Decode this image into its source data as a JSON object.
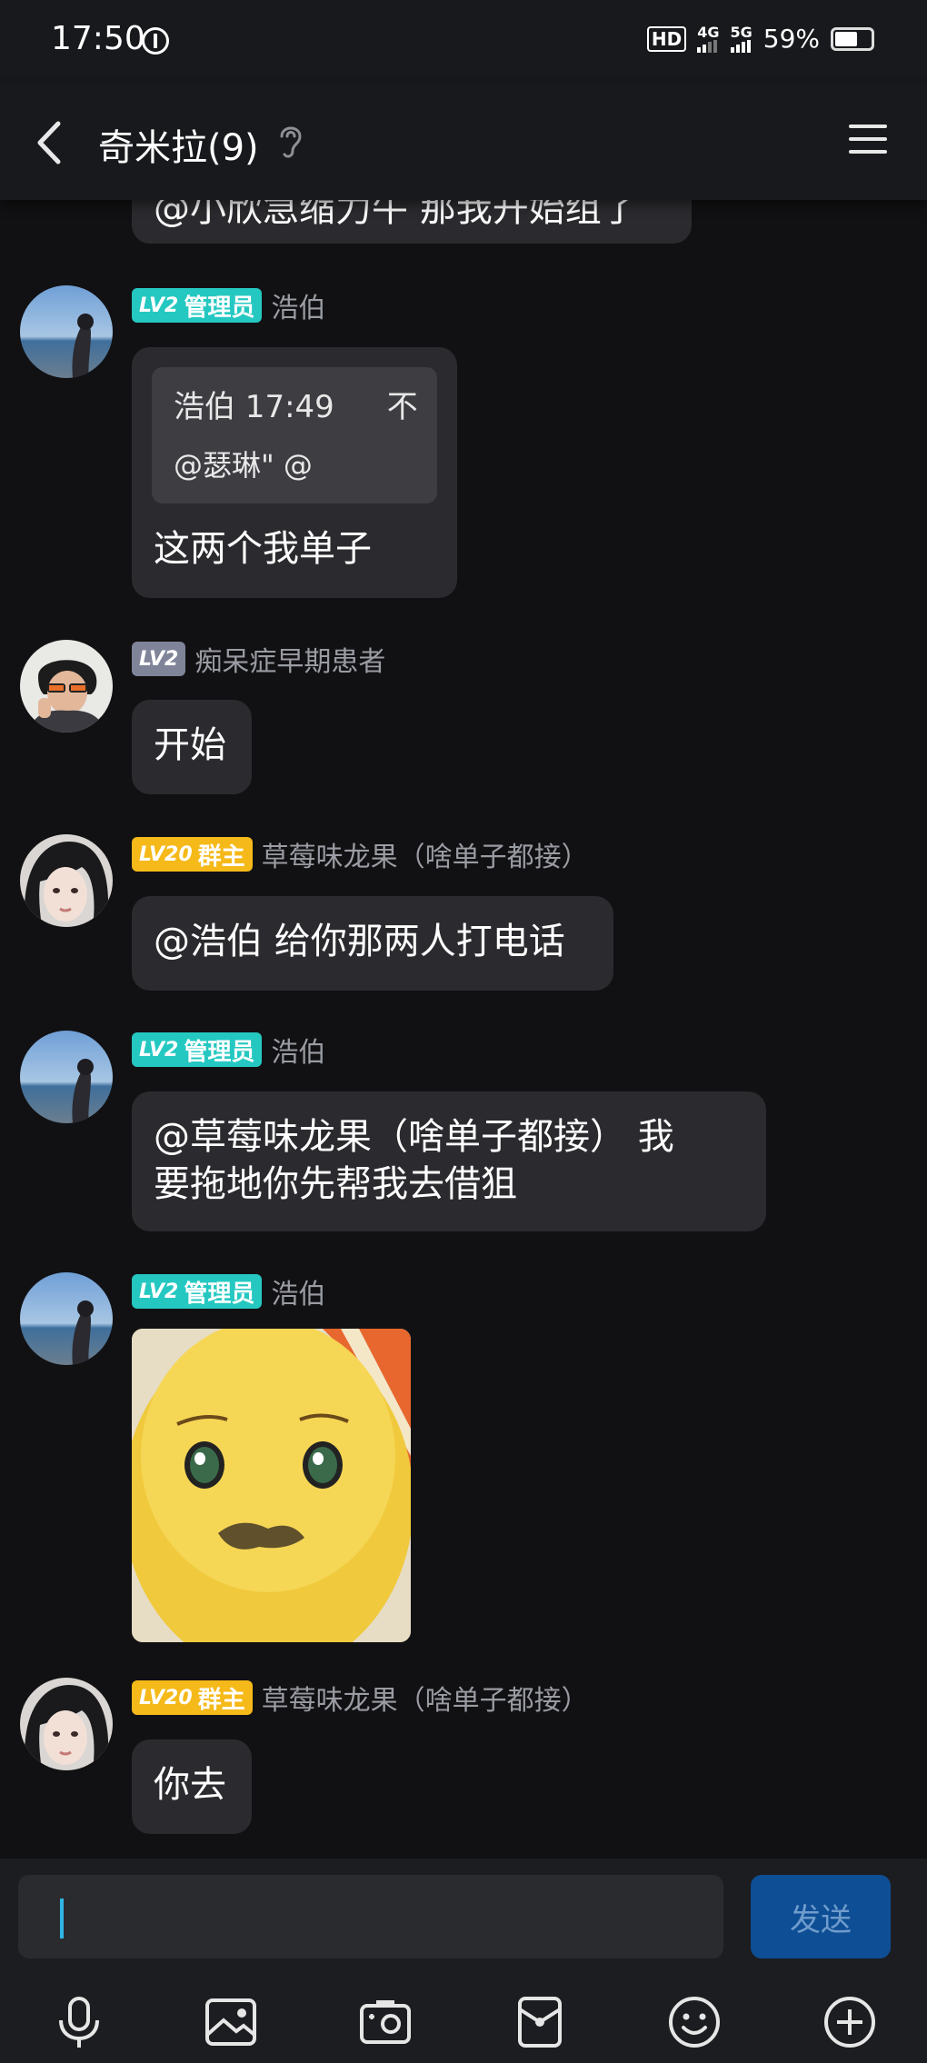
{
  "status_bar": {
    "time": "17:50",
    "hd": "HD",
    "net1": "4G",
    "net2": "5G",
    "battery": "59%"
  },
  "header": {
    "title": "奇米拉(9)",
    "back_icon": "chevron-left-icon",
    "menu_icon": "hamburger-menu-icon",
    "ear_icon": "ear-icon"
  },
  "messages": [
    {
      "text": "@小欣急缩力牛 那我开始组了"
    },
    {
      "level": "LV2",
      "role": "管理员",
      "sender": "浩伯",
      "quote": {
        "header": "浩伯 17:49",
        "tail": "不",
        "body": "@瑟琳\" @"
      },
      "text": "这两个我单子"
    },
    {
      "level": "LV2",
      "sender": "痴呆症早期患者",
      "text": "开始"
    },
    {
      "level": "LV20",
      "role": "群主",
      "sender": "草莓味龙果（啥单子都接）",
      "text": "@浩伯 给你那两人打电话"
    },
    {
      "level": "LV2",
      "role": "管理员",
      "sender": "浩伯",
      "text_line1": "@草莓味龙果（啥单子都接） 我",
      "text_line2": "要拖地你先帮我去借狙"
    },
    {
      "level": "LV2",
      "role": "管理员",
      "sender": "浩伯",
      "sticker": "yellow-character-sticker"
    },
    {
      "level": "LV20",
      "role": "群主",
      "sender": "草莓味龙果（啥单子都接）",
      "text": "你去"
    }
  ],
  "input": {
    "placeholder": "",
    "send_label": "发送"
  },
  "toolbar": [
    "microphone-icon",
    "image-icon",
    "camera-icon",
    "red-packet-icon",
    "emoji-icon",
    "plus-icon"
  ],
  "colors": {
    "admin_badge": "#25c8c1",
    "owner_badge": "#f5b919",
    "level_badge": "#7f8499",
    "send_button": "#0e4e95",
    "background": "#111113",
    "bubble": "#2b2b2f"
  }
}
